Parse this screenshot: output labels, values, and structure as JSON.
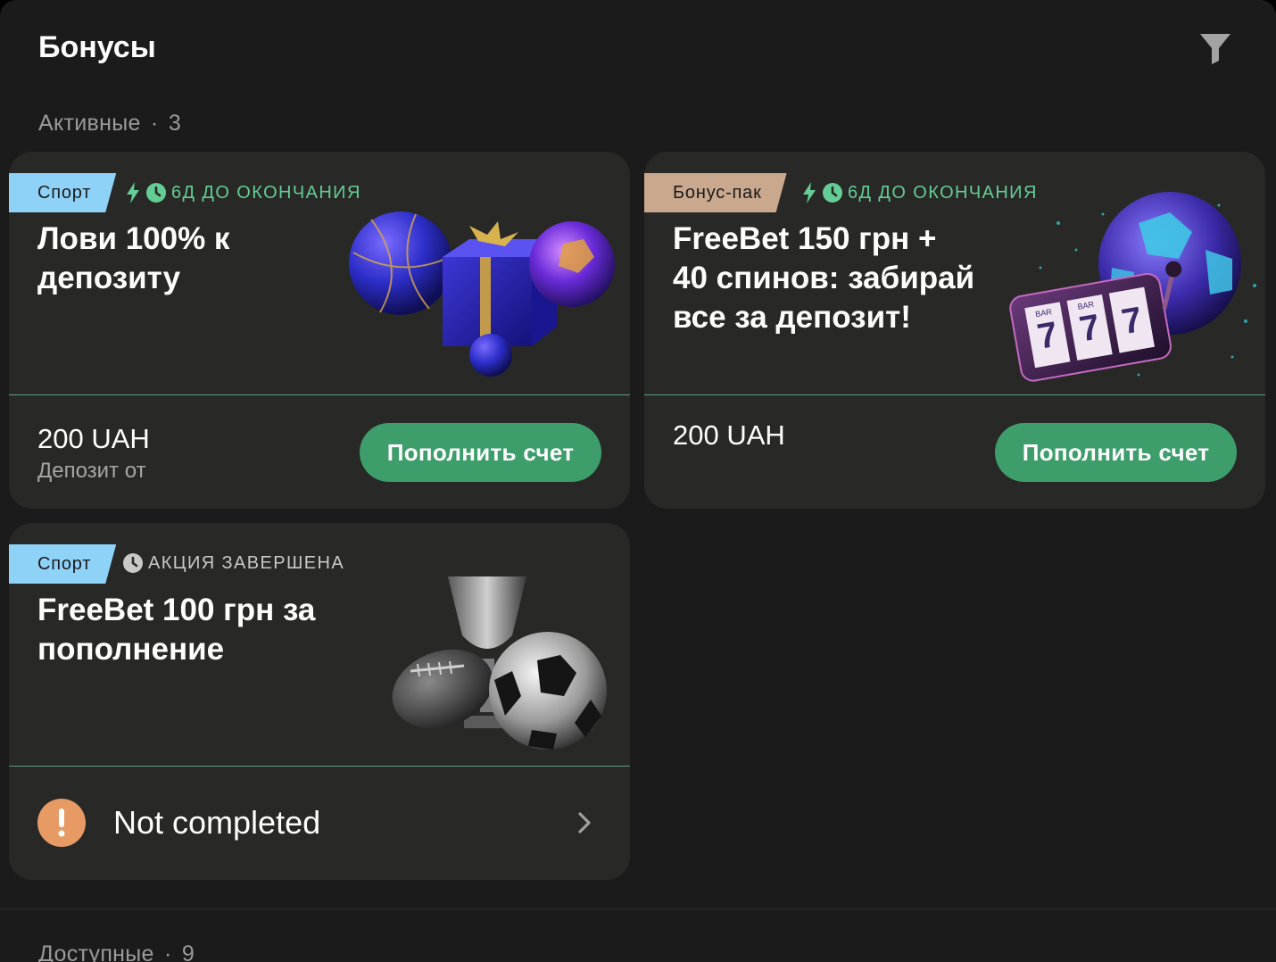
{
  "page": {
    "title": "Бонусы"
  },
  "sections": {
    "active": {
      "label": "Активные",
      "sep": "·",
      "count": "3"
    },
    "available": {
      "label": "Доступные",
      "sep": "·",
      "count": "9"
    }
  },
  "icons": {
    "filter": "filter-icon",
    "bolt": "lightning-icon",
    "clock": "clock-icon",
    "warning": "exclamation-icon",
    "chevron": "chevron-right-icon"
  },
  "colors": {
    "accent_green": "#3d9e6b",
    "timer_green": "#64cd94",
    "sport_tag": "#8fd2f8",
    "pack_tag": "#c9a88e",
    "warning": "#e79a64"
  },
  "cards": [
    {
      "tag": "Спорт",
      "timer": "6Д ДО ОКОНЧАНИЯ",
      "title_lines": [
        "Лови 100% к",
        "депозиту"
      ],
      "amount": "200 UAH",
      "amount_label": "Депозит от",
      "button": "Пополнить счет"
    },
    {
      "tag": "Бонус-пак",
      "timer": "6Д ДО ОКОНЧАНИЯ",
      "title_lines": [
        "FreeBet 150 грн +",
        "40 спинов: забирай",
        "все за депозит!"
      ],
      "amount": "200 UAH",
      "button": "Пополнить счет",
      "slot_labels": [
        "BAR",
        "BAR"
      ]
    },
    {
      "tag": "Спорт",
      "timer": "АКЦИЯ ЗАВЕРШЕНА",
      "title_lines": [
        "FreeBet 100 грн за",
        "пополнение"
      ],
      "status": "Not completed"
    }
  ]
}
